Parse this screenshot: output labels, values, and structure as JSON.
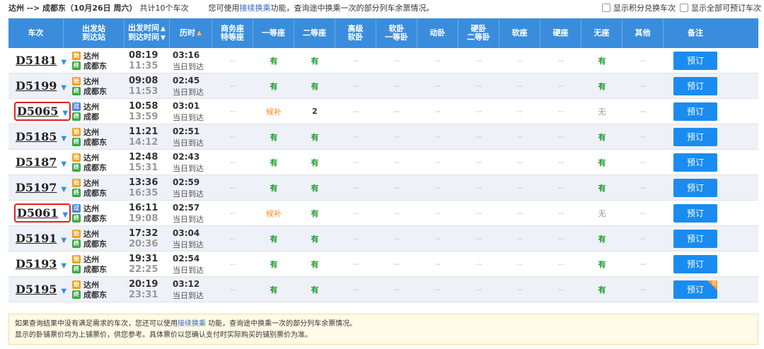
{
  "topbar": {
    "route": "达州 --> 成都东（10月26日 周六）",
    "count": "共计10个车次",
    "hint_prefix": "您可使用",
    "hint_link": "接续换乘",
    "hint_suffix": "功能，查询途中换乘一次的部分列车余票情况。",
    "opt1": "显示积分兑换车次",
    "opt2": "显示全部可预订车次"
  },
  "headers": {
    "train": "车次",
    "station_1": "出发站",
    "station_2": "到达站",
    "time_1": "出发时间",
    "time_2": "到达时间",
    "duration": "历时",
    "business_1": "商务座",
    "business_2": "特等座",
    "first": "一等座",
    "second": "二等座",
    "advsoft_1": "高级",
    "advsoft_2": "软卧",
    "softfirst_1": "软卧",
    "softfirst_2": "一等卧",
    "dongwo": "动卧",
    "hardsecond_1": "硬卧",
    "hardsecond_2": "二等卧",
    "softseat": "软座",
    "hardseat": "硬座",
    "noseat": "无座",
    "other": "其他",
    "note": "备注"
  },
  "same_day": "当日到达",
  "book_label": "预订",
  "corner_label": "兑",
  "rows": [
    {
      "train": "D5181",
      "from": "达州",
      "to": "成都东",
      "dep": "08:19",
      "arr": "11:35",
      "dur": "03:16",
      "from_badge": "始",
      "seats": [
        "--",
        "有",
        "有",
        "--",
        "--",
        "--",
        "--",
        "--",
        "--",
        "有",
        "--"
      ]
    },
    {
      "train": "D5199",
      "from": "达州",
      "to": "成都东",
      "dep": "09:08",
      "arr": "11:53",
      "dur": "02:45",
      "from_badge": "始",
      "seats": [
        "--",
        "有",
        "有",
        "--",
        "--",
        "--",
        "--",
        "--",
        "--",
        "有",
        "--"
      ]
    },
    {
      "train": "D5065",
      "from": "达州",
      "to": "成都",
      "dep": "10:58",
      "arr": "13:59",
      "dur": "03:01",
      "from_badge": "过",
      "seats": [
        "--",
        "候补",
        "2",
        "--",
        "--",
        "--",
        "--",
        "--",
        "--",
        "无",
        "--"
      ]
    },
    {
      "train": "D5185",
      "from": "达州",
      "to": "成都东",
      "dep": "11:21",
      "arr": "14:12",
      "dur": "02:51",
      "from_badge": "始",
      "seats": [
        "--",
        "有",
        "有",
        "--",
        "--",
        "--",
        "--",
        "--",
        "--",
        "有",
        "--"
      ]
    },
    {
      "train": "D5187",
      "from": "达州",
      "to": "成都东",
      "dep": "12:48",
      "arr": "15:31",
      "dur": "02:43",
      "from_badge": "始",
      "seats": [
        "--",
        "有",
        "有",
        "--",
        "--",
        "--",
        "--",
        "--",
        "--",
        "有",
        "--"
      ]
    },
    {
      "train": "D5197",
      "from": "达州",
      "to": "成都东",
      "dep": "13:36",
      "arr": "16:35",
      "dur": "02:59",
      "from_badge": "始",
      "seats": [
        "--",
        "有",
        "有",
        "--",
        "--",
        "--",
        "--",
        "--",
        "--",
        "有",
        "--"
      ]
    },
    {
      "train": "D5061",
      "from": "达州",
      "to": "成都东",
      "dep": "16:11",
      "arr": "19:08",
      "dur": "02:57",
      "from_badge": "过",
      "seats": [
        "--",
        "候补",
        "有",
        "--",
        "--",
        "--",
        "--",
        "--",
        "--",
        "无",
        "--"
      ]
    },
    {
      "train": "D5191",
      "from": "达州",
      "to": "成都东",
      "dep": "17:32",
      "arr": "20:36",
      "dur": "03:04",
      "from_badge": "始",
      "seats": [
        "--",
        "有",
        "有",
        "--",
        "--",
        "--",
        "--",
        "--",
        "--",
        "有",
        "--"
      ]
    },
    {
      "train": "D5193",
      "from": "达州",
      "to": "成都东",
      "dep": "19:31",
      "arr": "22:25",
      "dur": "02:54",
      "from_badge": "始",
      "seats": [
        "--",
        "有",
        "有",
        "--",
        "--",
        "--",
        "--",
        "--",
        "--",
        "有",
        "--"
      ]
    },
    {
      "train": "D5195",
      "from": "达州",
      "to": "成都东",
      "dep": "20:19",
      "arr": "23:31",
      "dur": "03:12",
      "from_badge": "始",
      "seats": [
        "--",
        "有",
        "有",
        "--",
        "--",
        "--",
        "--",
        "--",
        "--",
        "有",
        "--"
      ]
    }
  ],
  "boxed_trains": [
    "D5065",
    "D5061"
  ],
  "corner_train": "D5195",
  "to_badge": "终",
  "notice": {
    "line1_prefix": "如果查询结果中没有满足需求的车次，您还可以使用",
    "line1_link": "接续换乘",
    "line1_suffix": " 功能，查询途中换乘一次的部分列车余票情况。",
    "line2": "显示的卧铺票价均为上铺票价，供您参考。具体票价以您确认支付时实际购买的铺别票价为准。"
  },
  "colors": {
    "header_bg": "#3a8ddc",
    "available": "#1d9d2a",
    "waitlist": "#ff8a1f",
    "button": "#1a8cf0",
    "highlight_box": "#e02020"
  }
}
